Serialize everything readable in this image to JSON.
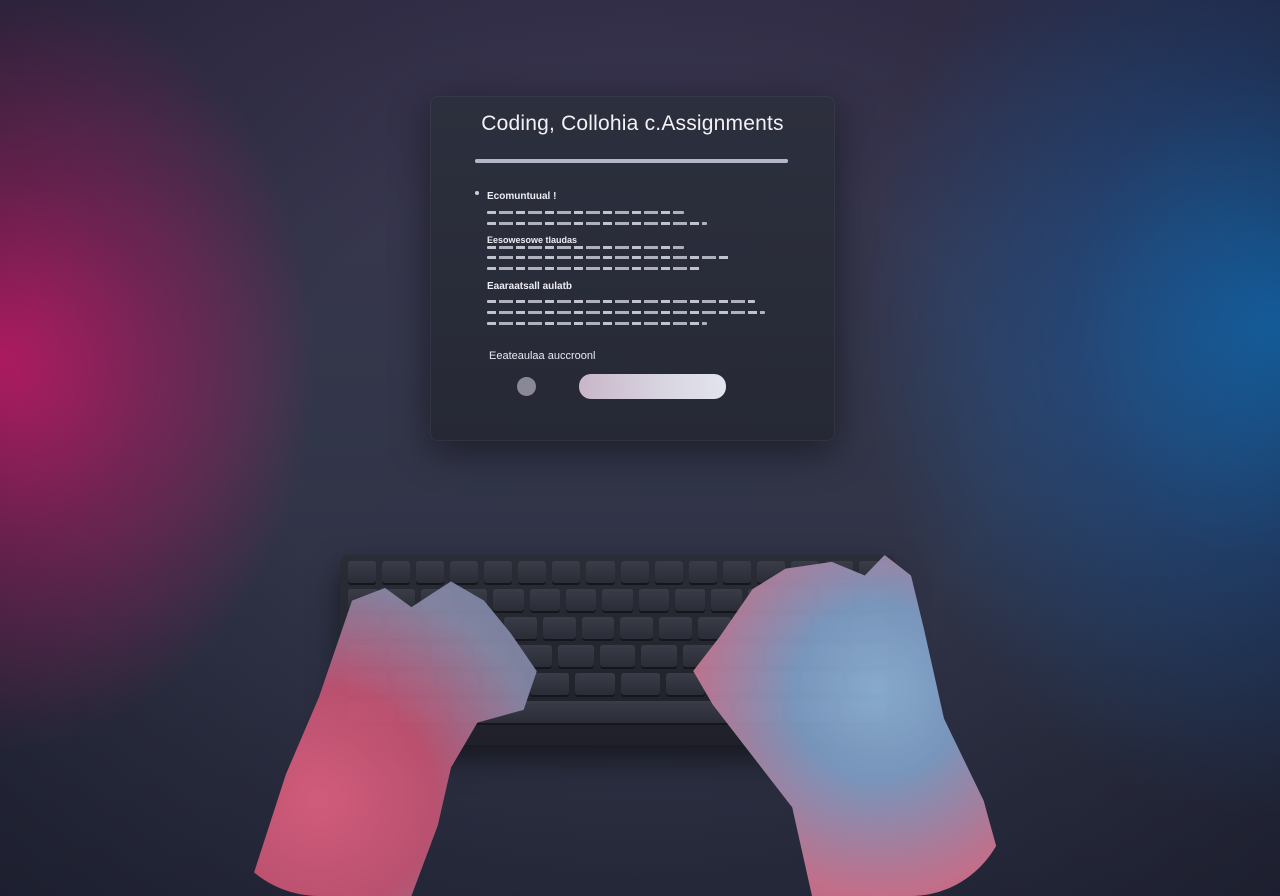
{
  "panel": {
    "title": "Coding, Collohia c.Assignments",
    "progress": 1.0,
    "section1_heading": "Ecomuntuual !",
    "section2_heading": "Eesowesowe tlaudas",
    "section3_heading": "Eaaraatsall aulatb",
    "footer_label": "Eeateaulaa auccroonl"
  },
  "colors": {
    "accent_pink": "#e81e78",
    "accent_blue": "#1478c8",
    "panel_bg": "#2a2d3a"
  }
}
